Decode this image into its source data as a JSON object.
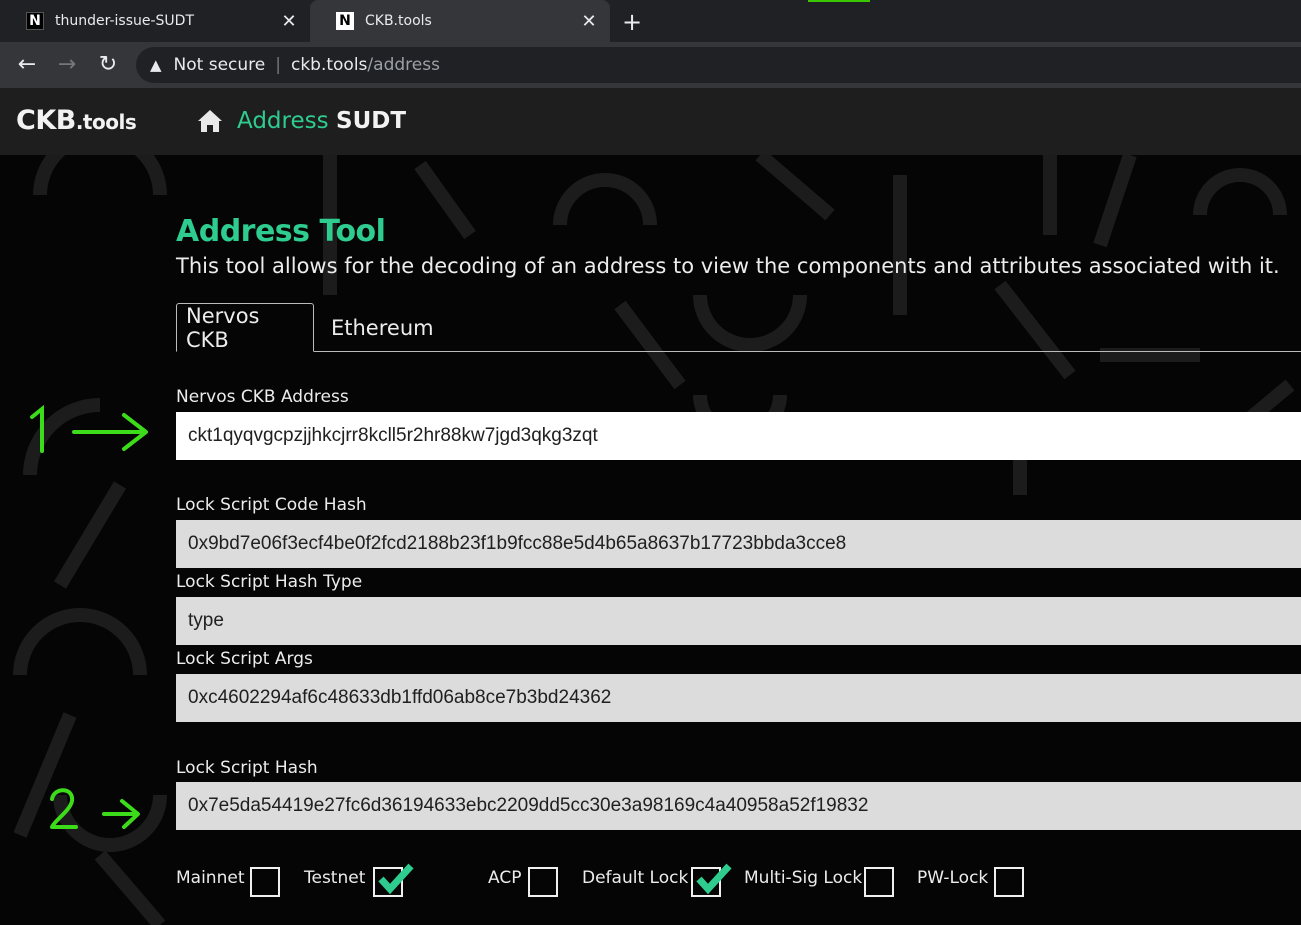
{
  "browser": {
    "tabs": [
      {
        "title": "thunder-issue-SUDT",
        "favicon": "N"
      },
      {
        "title": "CKB.tools",
        "favicon": "N"
      }
    ],
    "security": "Not secure",
    "url_host": "ckb.tools",
    "url_path": "/address"
  },
  "app": {
    "logo_main": "CKB",
    "logo_sub": ".tools",
    "nav": {
      "address": "Address",
      "sudt": "SUDT"
    }
  },
  "page": {
    "title": "Address Tool",
    "description": "This tool allows for the decoding of an address to view the components and attributes associated with it.",
    "tabs": {
      "nervos": "Nervos CKB",
      "ethereum": "Ethereum"
    }
  },
  "fields": {
    "address": {
      "label": "Nervos CKB Address",
      "value": "ckt1qyqvgcpzjjhkcjrr8kcll5r2hr88kw7jgd3qkg3zqt"
    },
    "code_hash": {
      "label": "Lock Script Code Hash",
      "value": "0x9bd7e06f3ecf4be0f2fcd2188b23f1b9fcc88e5d4b65a8637b17723bbda3cce8"
    },
    "hash_type": {
      "label": "Lock Script Hash Type",
      "value": "type"
    },
    "args": {
      "label": "Lock Script Args",
      "value": "0xc4602294af6c48633db1ffd06ab8ce7b3bd24362"
    },
    "lock_hash": {
      "label": "Lock Script Hash",
      "value": "0x7e5da54419e27fc6d36194633ebc2209dd5cc30e3a98169c4a40958a52f19832"
    }
  },
  "checkboxes": {
    "mainnet": {
      "label": "Mainnet",
      "checked": false
    },
    "testnet": {
      "label": "Testnet",
      "checked": true
    },
    "acp": {
      "label": "ACP",
      "checked": false
    },
    "default_lock": {
      "label": "Default Lock",
      "checked": true
    },
    "multisig": {
      "label": "Multi-Sig Lock",
      "checked": false
    },
    "pwlock": {
      "label": "PW-Lock",
      "checked": false
    }
  },
  "annotations": {
    "one": "1",
    "two": "2"
  },
  "colors": {
    "accent": "#2ecc8f",
    "annotation": "#3ddc1a"
  }
}
